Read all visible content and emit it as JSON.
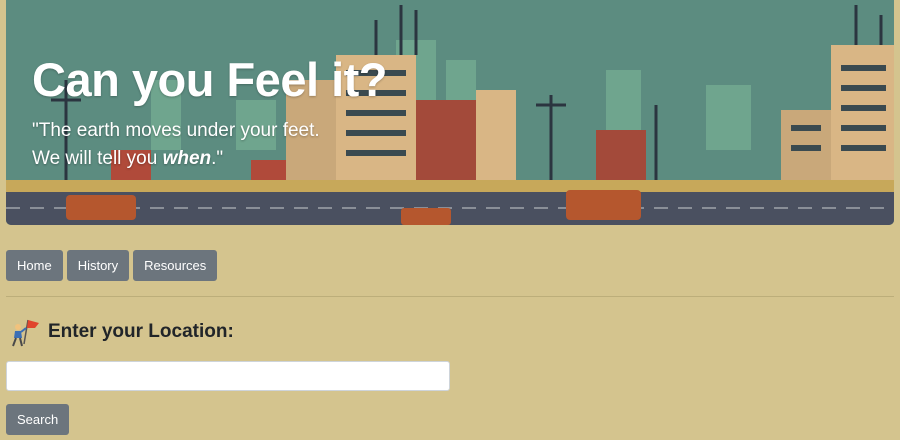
{
  "hero": {
    "title": "Can you Feel it?",
    "tagline_line1": "\"The earth moves under your feet.",
    "tagline_line2_prefix": "We will tell you ",
    "tagline_line2_emphasis": "when",
    "tagline_line2_suffix": ".\"",
    "image_icon": "ruined-city-illustration"
  },
  "nav": {
    "items": [
      {
        "label": "Home"
      },
      {
        "label": "History"
      },
      {
        "label": "Resources"
      }
    ]
  },
  "location": {
    "heading": "Enter your Location:",
    "icon": "flag-person-icon",
    "input_value": "",
    "input_placeholder": "",
    "search_label": "Search"
  },
  "colors": {
    "page_background": "#d4c48e",
    "button": "#6c757d",
    "sky": "#5c8c80",
    "road": "#4a5060"
  }
}
